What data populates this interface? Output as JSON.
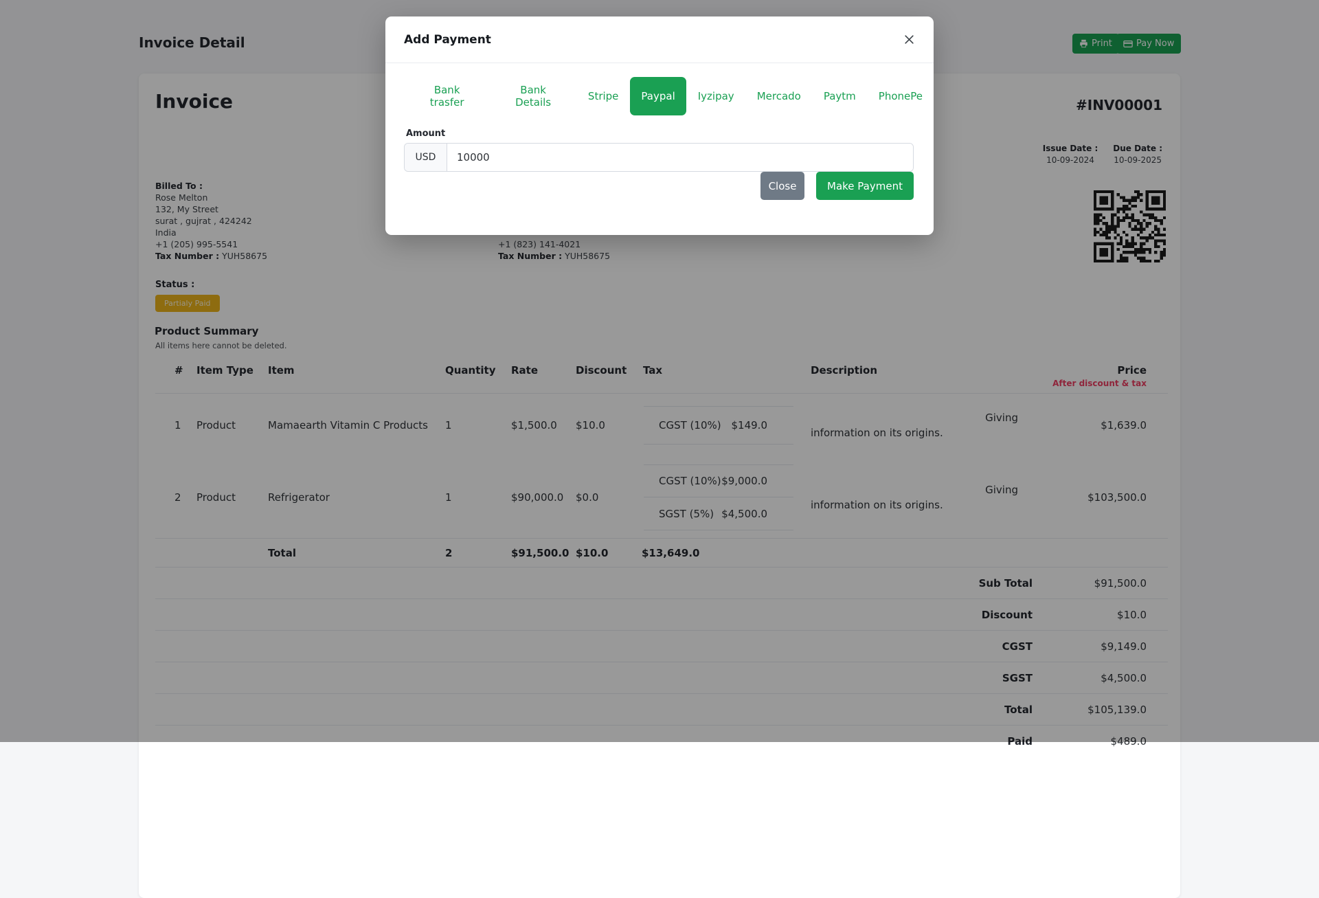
{
  "page": {
    "title": "Invoice Detail",
    "print_label": "Print",
    "pay_now_label": "Pay Now"
  },
  "icons": {
    "print": "printer-icon",
    "pay_now": "credit-card-icon",
    "modal_close": "close-icon",
    "qr": "qr-code"
  },
  "colors": {
    "accent_green": "#1aa053",
    "badge_amber": "#edb41b",
    "price_note_red": "#ef3f63",
    "close_gray": "#6f7a86"
  },
  "invoice": {
    "heading": "Invoice",
    "number": "#INV00001",
    "issue_date_label": "Issue Date :",
    "issue_date": "10-09-2024",
    "due_date_label": "Due Date :",
    "due_date": "10-09-2025",
    "billed_to": {
      "label": "Billed To :",
      "name": "Rose Melton",
      "address1": "132, My Street",
      "address2": "surat , gujrat , 424242",
      "country": "India",
      "phone": "+1 (205) 995-5541",
      "tax_label": "Tax Number :",
      "tax_number": "YUH58675"
    },
    "shipping_contact": {
      "phone": "+1 (823) 141-4021",
      "tax_label": "Tax Number :",
      "tax_number": "YUH58675"
    },
    "status_label": "Status :",
    "status_badge": "Partialy Paid"
  },
  "product_summary": {
    "title": "Product Summary",
    "subtitle": "All items here cannot be deleted."
  },
  "table": {
    "headers": {
      "num": "#",
      "item_type": "Item Type",
      "item": "Item",
      "quantity": "Quantity",
      "rate": "Rate",
      "discount": "Discount",
      "tax": "Tax",
      "description": "Description",
      "price": "Price",
      "price_sub": "After discount & tax"
    },
    "rows": [
      {
        "num": "1",
        "item_type": "Product",
        "item": "Mamaearth Vitamin C Products",
        "quantity": "1",
        "rate": "$1,500.0",
        "discount": "$10.0",
        "taxes": [
          {
            "label": "CGST (10%)",
            "value": "$149.0"
          }
        ],
        "desc_line1": "Giving",
        "desc_line2": "information on its origins.",
        "price": "$1,639.0"
      },
      {
        "num": "2",
        "item_type": "Product",
        "item": "Refrigerator",
        "quantity": "1",
        "rate": "$90,000.0",
        "discount": "$0.0",
        "taxes": [
          {
            "label": "CGST (10%)",
            "value": "$9,000.0"
          },
          {
            "label": "SGST (5%)",
            "value": "$4,500.0"
          }
        ],
        "desc_line1": "Giving",
        "desc_line2": "information on its origins.",
        "price": "$103,500.0"
      }
    ],
    "totals_row": {
      "label": "Total",
      "quantity": "2",
      "rate": "$91,500.0",
      "discount": "$10.0",
      "tax": "$13,649.0"
    },
    "summary": [
      {
        "label": "Sub Total",
        "value": "$91,500.0"
      },
      {
        "label": "Discount",
        "value": "$10.0"
      },
      {
        "label": "CGST",
        "value": "$9,149.0"
      },
      {
        "label": "SGST",
        "value": "$4,500.0"
      },
      {
        "label": "Total",
        "value": "$105,139.0"
      },
      {
        "label": "Paid",
        "value": "$489.0"
      }
    ]
  },
  "modal": {
    "title": "Add Payment",
    "tabs": [
      {
        "label": "Bank trasfer",
        "active": false
      },
      {
        "label": "Bank Details",
        "active": false
      },
      {
        "label": "Stripe",
        "active": false
      },
      {
        "label": "Paypal",
        "active": true
      },
      {
        "label": "Iyzipay",
        "active": false
      },
      {
        "label": "Mercado",
        "active": false
      },
      {
        "label": "Paytm",
        "active": false
      },
      {
        "label": "PhonePe",
        "active": false
      }
    ],
    "amount_label": "Amount",
    "currency": "USD",
    "amount_value": "10000",
    "close_button": "Close",
    "make_payment_button": "Make Payment"
  }
}
